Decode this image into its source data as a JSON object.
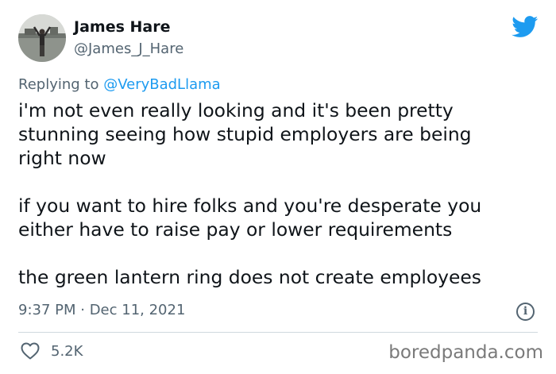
{
  "author": {
    "name": "James Hare",
    "handle": "@James_J_Hare"
  },
  "reply": {
    "prefix": "Replying to ",
    "mention": "@VeryBadLlama"
  },
  "tweet": {
    "paragraph1": [
      "i'm not even really looking and it's been pretty",
      "stunning seeing how stupid employers are being",
      "right now"
    ],
    "paragraph2": [
      "if you want to hire folks and you're desperate you",
      "either have to raise pay or lower requirements"
    ],
    "paragraph3": [
      "the green lantern ring does not create employees"
    ],
    "timestamp": "9:37 PM · Dec 11, 2021"
  },
  "stats": {
    "likes": "5.2K"
  },
  "watermark": "boredpanda.com",
  "icons": {
    "platform": "twitter-bird-icon",
    "info": "info-icon",
    "like": "heart-icon"
  },
  "colors": {
    "accent": "#1d9bf0",
    "text": "#0f1419",
    "muted": "#536471",
    "divider": "#cfd9de"
  }
}
